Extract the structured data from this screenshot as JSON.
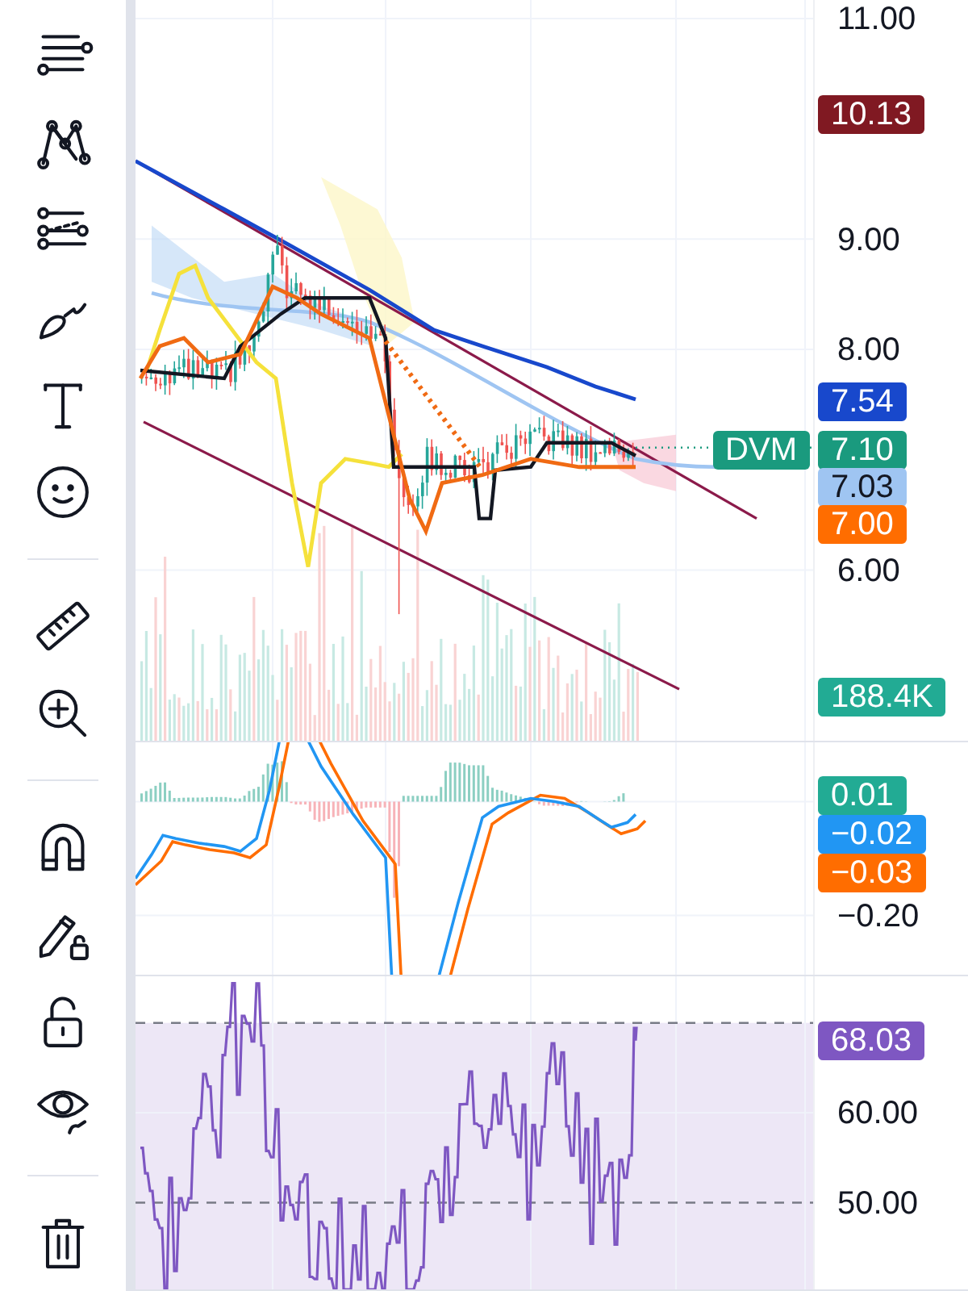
{
  "price_pane": {
    "axis_labels": [
      "11.00",
      "9.00",
      "8.00",
      "6.00"
    ],
    "price_tags": [
      {
        "text": "10.13",
        "color": "#801922"
      },
      {
        "text": "7.54",
        "color": "#1848cc"
      },
      {
        "text": "7.10",
        "color": "#1a9a7e",
        "label": "DVM"
      },
      {
        "text": "7.03",
        "color": "#9fc5f2"
      },
      {
        "text": "7.00",
        "color": "#ff6d00"
      }
    ],
    "volume_tag": {
      "text": "188.4K",
      "color": "#22ab94"
    }
  },
  "macd_pane": {
    "axis_labels": [
      "−0.20"
    ],
    "tags": [
      {
        "text": "0.01",
        "color": "#22ab94"
      },
      {
        "text": "−0.02",
        "color": "#2196f3"
      },
      {
        "text": "−0.03",
        "color": "#ff6d00"
      }
    ]
  },
  "rsi_pane": {
    "axis_labels": [
      "60.00",
      "50.00"
    ],
    "tags": [
      {
        "text": "68.03",
        "color": "#7e57c2"
      }
    ]
  }
}
